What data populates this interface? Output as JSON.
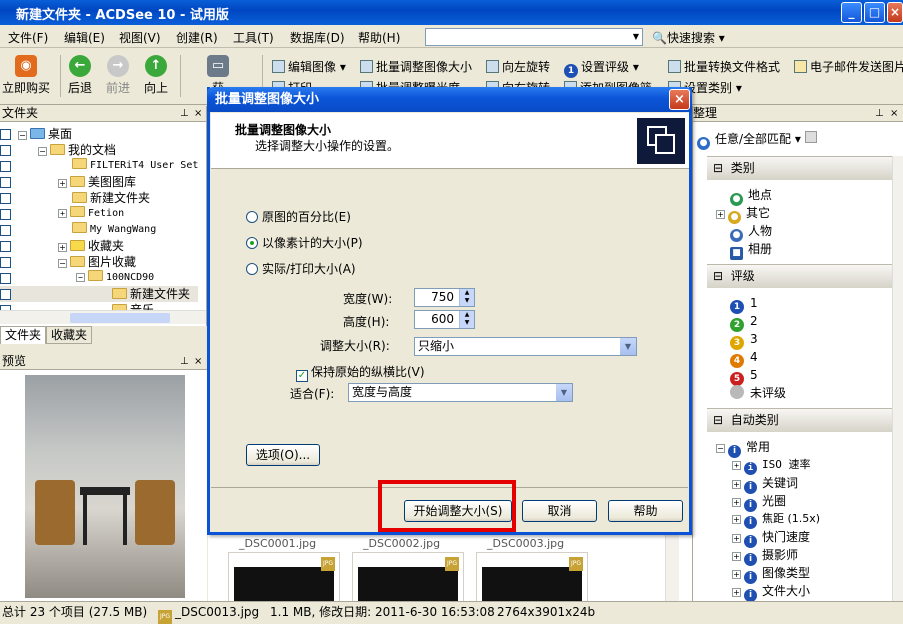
{
  "window": {
    "title": "新建文件夹 - ACDSee 10 - 试用版"
  },
  "menu": [
    "文件(F)",
    "编辑(E)",
    "视图(V)",
    "创建(R)",
    "工具(T)",
    "数据库(D)",
    "帮助(H)"
  ],
  "quick_search": "快速搜索",
  "toolbar": {
    "buy": "立即购买",
    "back": "后退",
    "forward": "前进",
    "up": "向上",
    "acquire": "获",
    "edit_image": "编辑图像",
    "batch_resize": "批量调整图像大小",
    "rotate_left": "向左旋转",
    "set_rating": "设置评级",
    "batch_convert": "批量转换文件格式",
    "email": "电子邮件发送图片",
    "print": "打印",
    "batch_exposure": "批量调整曝光度",
    "rotate_right": "向右旋转",
    "add_to_basket": "添加到图像篮",
    "set_category": "设置类别"
  },
  "folder_pane": {
    "title": "文件夹",
    "items": [
      "桌面",
      "我的文档",
      "FILTERiT4 User Set",
      "美图图库",
      "新建文件夹",
      "Fetion",
      "My WangWang",
      "收藏夹",
      "图片收藏",
      "100NCD90",
      "新建文件夹",
      "音乐"
    ],
    "tabs": [
      "文件夹",
      "收藏夹"
    ]
  },
  "preview_pane": {
    "title": "预览"
  },
  "right_pane": {
    "title": "整理",
    "filter": "任意/全部匹配",
    "sections": {
      "category": {
        "title": "类别",
        "items": [
          "地点",
          "其它",
          "人物",
          "相册"
        ]
      },
      "rating": {
        "title": "评级",
        "items": [
          "1",
          "2",
          "3",
          "4",
          "5",
          "未评级"
        ]
      },
      "auto": {
        "title": "自动类别",
        "items": [
          "常用",
          "ISO 速率",
          "关键词",
          "光圈",
          "焦距 (1.5x)",
          "快门速度",
          "摄影师",
          "图像类型",
          "文件大小"
        ]
      }
    },
    "colors": {
      "r1": "#1e4fb5",
      "r2": "#2ea12e",
      "r3": "#e0a600",
      "r4": "#e07b00",
      "r5": "#cc1f1f",
      "none": "#b9b9b9"
    }
  },
  "thumbs": [
    "_DSC0001.jpg",
    "_DSC0002.jpg",
    "_DSC0003.jpg"
  ],
  "statusbar": {
    "total": "总计 23 个项目 (27.5 MB)",
    "file": "_DSC0013.jpg",
    "info": "1.1 MB, 修改日期: 2011-6-30 16:53:08",
    "dims": "2764x3901x24b"
  },
  "dialog": {
    "title": "批量调整图像大小",
    "heading": "批量调整图像大小",
    "subheading": "选择调整大小操作的设置。",
    "radio_percent": "原图的百分比(E)",
    "radio_pixels": "以像素计的大小(P)",
    "radio_print": "实际/打印大小(A)",
    "width_label": "宽度(W):",
    "width_value": "750",
    "height_label": "高度(H):",
    "height_value": "600",
    "resize_label": "调整大小(R):",
    "resize_value": "只缩小",
    "keep_ratio": "保持原始的纵横比(V)",
    "fit_label": "适合(F):",
    "fit_value": "宽度与高度",
    "options_btn": "选项(O)...",
    "start_btn": "开始调整大小(S)",
    "cancel_btn": "取消",
    "help_btn": "帮助"
  }
}
